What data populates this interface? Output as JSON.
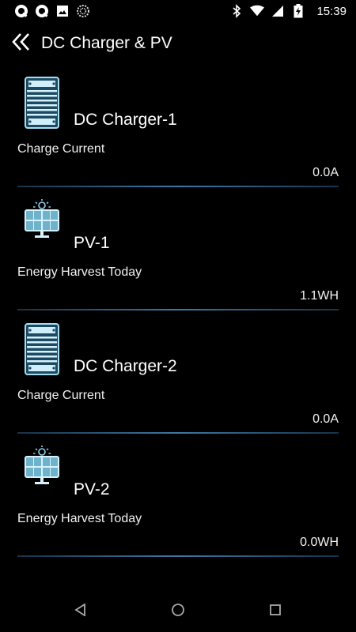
{
  "status_bar": {
    "time": "15:39",
    "icons": [
      "q-app-icon",
      "q-app-icon",
      "image-icon",
      "loading-icon",
      "bluetooth-icon",
      "wifi-icon",
      "signal-icon",
      "battery-charging-icon"
    ]
  },
  "header": {
    "title": "DC Charger & PV",
    "back_icon": "double-chevron-left-icon"
  },
  "devices": [
    {
      "name": "DC Charger-1",
      "icon": "dc-charger-icon",
      "metric_label": "Charge Current",
      "metric_value": "0.0A"
    },
    {
      "name": "PV-1",
      "icon": "solar-panel-icon",
      "metric_label": "Energy Harvest Today",
      "metric_value": "1.1WH"
    },
    {
      "name": "DC Charger-2",
      "icon": "dc-charger-icon",
      "metric_label": "Charge Current",
      "metric_value": "0.0A"
    },
    {
      "name": "PV-2",
      "icon": "solar-panel-icon",
      "metric_label": "Energy Harvest Today",
      "metric_value": "0.0WH"
    }
  ],
  "colors": {
    "background": "#000000",
    "divider": "#3f78a6",
    "icon_accent": "#8fd0ea"
  },
  "nav": {
    "buttons": [
      "back-triangle-icon",
      "home-circle-icon",
      "recents-square-icon"
    ]
  }
}
